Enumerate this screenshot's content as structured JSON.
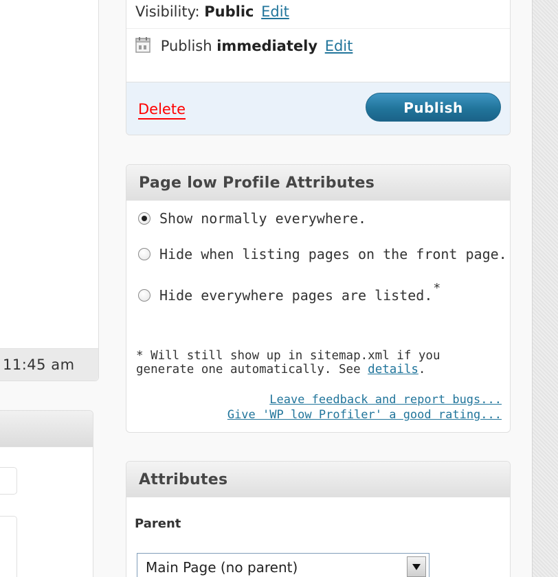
{
  "left_panel": {
    "timestamp": "11:45 am"
  },
  "publish": {
    "visibility_label": "Visibility:",
    "visibility_value": "Public",
    "visibility_edit": "Edit",
    "schedule_label": "Publish",
    "schedule_value": "immediately",
    "schedule_edit": "Edit",
    "calendar_icon": "calendar-icon",
    "delete_label": "Delete",
    "publish_label": "Publish",
    "colors": {
      "accent": "#21759b",
      "delete": "#ff0000",
      "actions_bg": "#eaf2fa"
    }
  },
  "low_profile": {
    "title": "Page low Profile Attributes",
    "options": [
      {
        "label": "Show normally everywhere.",
        "checked": true
      },
      {
        "label": "Hide when listing pages on the front page.",
        "checked": false
      },
      {
        "label": "Hide everywhere pages are listed.",
        "checked": false,
        "marker": "*"
      }
    ],
    "note_line1": "* Will still show up in sitemap.xml if you",
    "note_line2": "generate one automatically. See ",
    "note_link": "details",
    "note_end": ".",
    "feedback_link": "Leave feedback and report bugs...",
    "rating_link": "Give 'WP low Profiler' a good rating..."
  },
  "attributes": {
    "title": "Attributes",
    "parent_label": "Parent",
    "parent_selected": "Main Page (no parent)"
  }
}
